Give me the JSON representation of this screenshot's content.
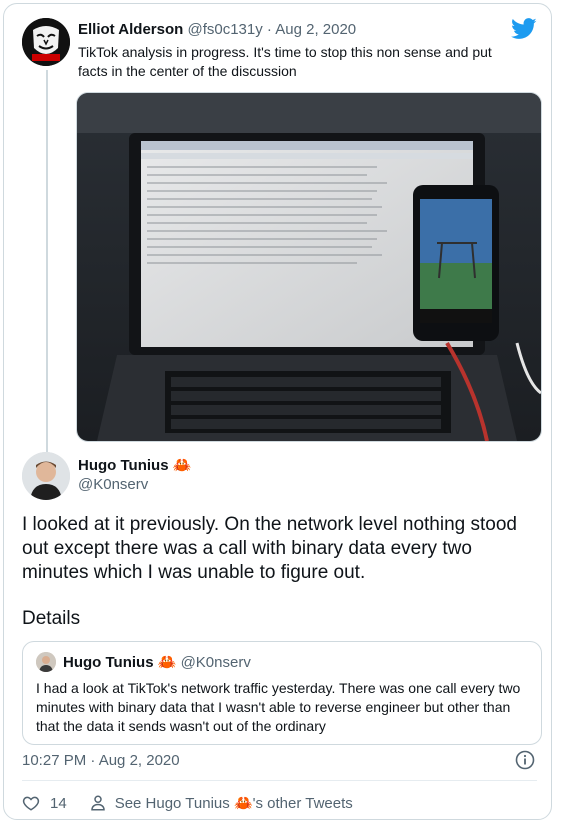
{
  "parent": {
    "name": "Elliot Alderson",
    "handle": "@fs0c131y",
    "separator": "·",
    "date": "Aug 2, 2020",
    "text": "TikTok analysis in progress. It's time to stop this non sense and put facts in the center of the discussion",
    "avatar_icon": "mask-logo-icon",
    "media_icon": "laptop-phone-photo"
  },
  "tweet": {
    "name": "Hugo Tunius",
    "handle": "@K0nserv",
    "emoji": "🦀",
    "text": "I looked at it previously. On the network level nothing stood out except there was a call with binary data every two minutes which I was unable to figure out.",
    "details": "Details",
    "timestamp": "10:27 PM · Aug 2, 2020"
  },
  "quote": {
    "name": "Hugo Tunius",
    "handle": "@K0nserv",
    "emoji": "🦀",
    "text": "I had a look at TikTok's network traffic yesterday. There was one call every two minutes with binary data that I wasn't able to reverse engineer but other than that the data it sends wasn't out of the ordinary"
  },
  "actions": {
    "like_count": "14",
    "see_prefix": "See Hugo Tunius",
    "see_emoji": "🦀",
    "see_suffix": "'s other Tweets"
  },
  "colors": {
    "twitter_blue": "#1d9bf0",
    "muted": "#536471",
    "border": "#cfd9de",
    "crab_red": "#d0342c"
  }
}
